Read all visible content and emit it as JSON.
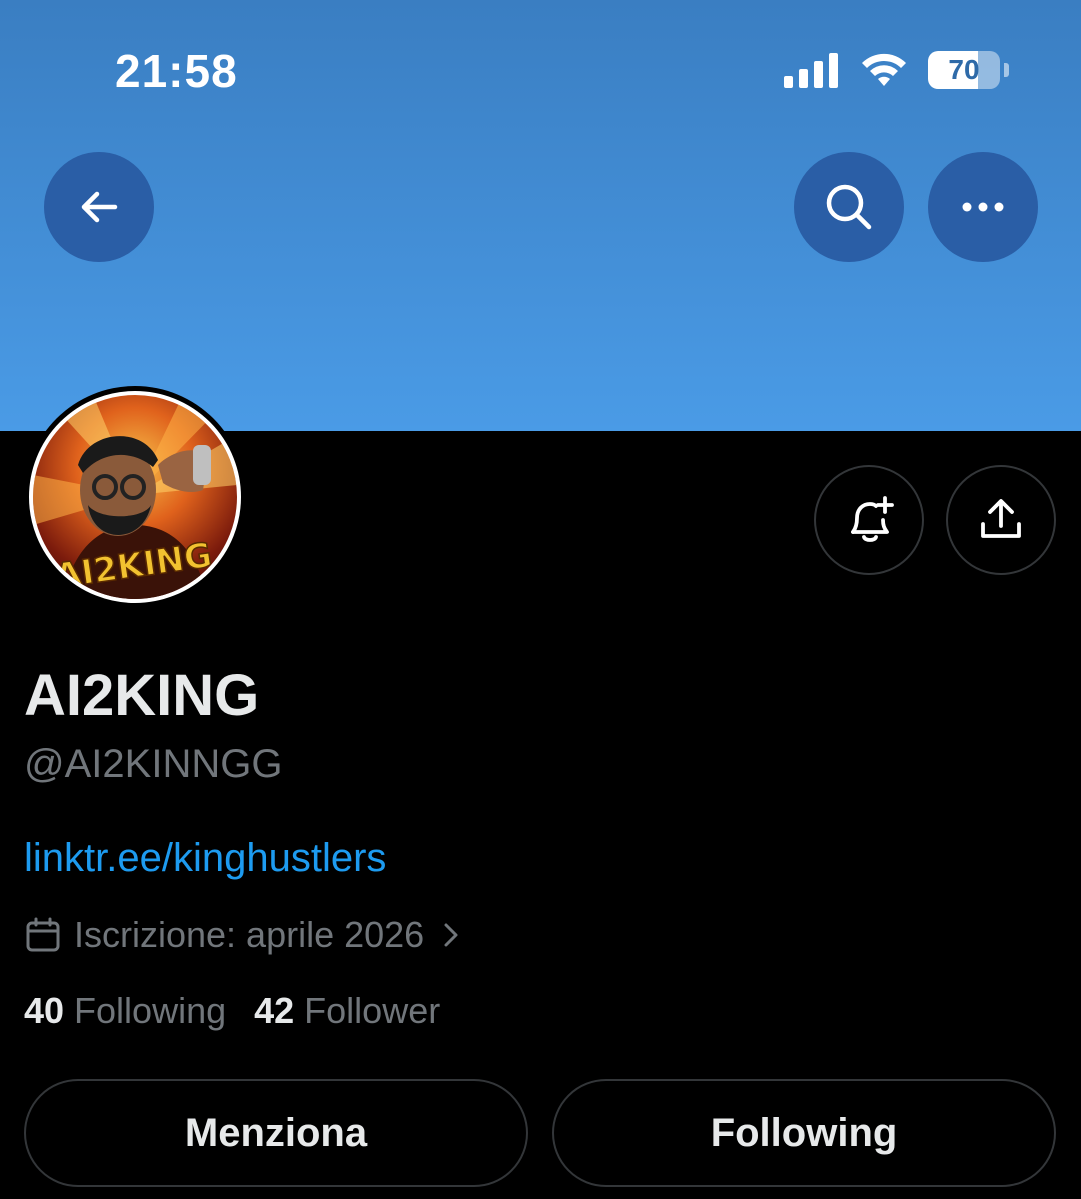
{
  "status_bar": {
    "time": "21:58",
    "battery_percent": 70
  },
  "header": {
    "back_icon": "arrow-left-icon",
    "search_icon": "search-icon",
    "more_icon": "ellipsis-icon",
    "banner_color": "#4a9be6"
  },
  "profile": {
    "avatar_text": "AI2KING",
    "name": "AI2KING",
    "handle": "@AI2KINNGG",
    "link": "linktr.ee/kinghustlers",
    "joined": "Iscrizione: aprile 2026",
    "following_count": "40",
    "following_label": "Following",
    "followers_count": "42",
    "followers_label": "Follower"
  },
  "actions": {
    "notify_icon": "bell-plus-icon",
    "share_icon": "share-upload-icon",
    "mention_label": "Menziona",
    "following_button_label": "Following"
  },
  "colors": {
    "link": "#1d9bf0",
    "muted": "#71767b",
    "text": "#e7e9ea",
    "header_button": "#2a5ea6"
  }
}
